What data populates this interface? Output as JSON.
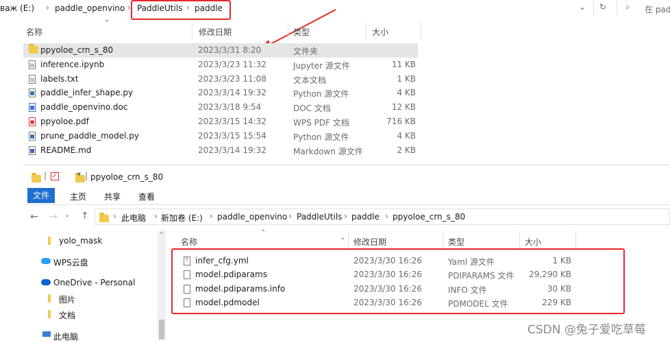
{
  "top_window": {
    "breadcrumb": [
      {
        "label": "важ (E:)",
        "display": "важ (E:)"
      }
    ],
    "crumbs": [
      "важ (E:)",
      "paddle_openvino",
      "PaddleUtils",
      "paddle"
    ],
    "search_placeholder": "在 pado",
    "columns": {
      "name": "名称",
      "modified": "修改日期",
      "type": "类型",
      "size": "大小"
    },
    "files": [
      {
        "name": "ppyoloe_crn_s_80",
        "modified": "2023/3/31 8:20",
        "type": "文件夹",
        "size": "",
        "icon": "folder-icon"
      },
      {
        "name": "inference.ipynb",
        "modified": "2023/3/23 11:32",
        "type": "Jupyter 源文件",
        "size": "11 KB",
        "icon": "notebook-file-icon"
      },
      {
        "name": "labels.txt",
        "modified": "2023/3/23 11:08",
        "type": "文本文档",
        "size": "1 KB",
        "icon": "text-file-icon"
      },
      {
        "name": "paddle_infer_shape.py",
        "modified": "2023/3/14 19:32",
        "type": "Python 源文件",
        "size": "4 KB",
        "icon": "python-file-icon"
      },
      {
        "name": "paddle_openvino.doc",
        "modified": "2023/3/18 9:54",
        "type": "DOC 文档",
        "size": "12 KB",
        "icon": "doc-file-icon"
      },
      {
        "name": "ppyoloe.pdf",
        "modified": "2023/3/15 14:32",
        "type": "WPS PDF 文档",
        "size": "716 KB",
        "icon": "pdf-file-icon"
      },
      {
        "name": "prune_paddle_model.py",
        "modified": "2023/3/15 15:54",
        "type": "Python 源文件",
        "size": "4 KB",
        "icon": "python-file-icon"
      },
      {
        "name": "README.md",
        "modified": "2023/3/14 19:32",
        "type": "Markdown 源文件",
        "size": "2 KB",
        "icon": "markdown-file-icon"
      }
    ]
  },
  "bottom_window": {
    "title": "ppyoloe_crn_s_80",
    "ribbon_tabs": [
      "文件",
      "主页",
      "共享",
      "查看"
    ],
    "address": [
      "此电脑",
      "新加卷 (E:)",
      "paddle_openvino",
      "PaddleUtils",
      "paddle",
      "ppyoloe_crn_s_80"
    ],
    "nav": [
      {
        "label": "yolo_mask",
        "icon": "folder-icon"
      },
      {
        "label": "WPS云盘",
        "icon": "cloud-icon"
      },
      {
        "label": "OneDrive - Personal",
        "icon": "onedrive-cloud-icon"
      },
      {
        "label": "图片",
        "icon": "folder-icon"
      },
      {
        "label": "文档",
        "icon": "folder-icon"
      },
      {
        "label": "此电脑",
        "icon": "computer-icon"
      }
    ],
    "columns": {
      "name": "名称",
      "modified": "修改日期",
      "type": "类型",
      "size": "大小"
    },
    "files": [
      {
        "name": "infer_cfg.yml",
        "modified": "2023/3/30 16:26",
        "type": "Yaml 源文件",
        "size": "1 KB",
        "icon": "yaml-file-icon"
      },
      {
        "name": "model.pdiparams",
        "modified": "2023/3/30 16:26",
        "type": "PDIPARAMS 文件",
        "size": "29,290 KB",
        "icon": "generic-file-icon"
      },
      {
        "name": "model.pdiparams.info",
        "modified": "2023/3/30 16:26",
        "type": "INFO 文件",
        "size": "30 KB",
        "icon": "generic-file-icon"
      },
      {
        "name": "model.pdmodel",
        "modified": "2023/3/30 16:26",
        "type": "PDMODEL 文件",
        "size": "229 KB",
        "icon": "generic-file-icon"
      }
    ]
  },
  "watermark": "CSDN @兔子爱吃草莓",
  "accent_color": "#e8262b"
}
